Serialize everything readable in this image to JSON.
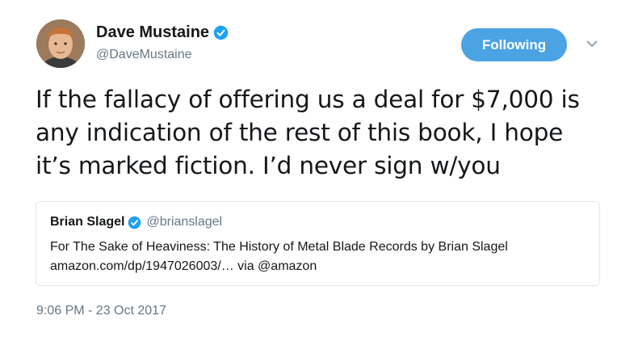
{
  "author": {
    "display_name": "Dave Mustaine",
    "handle": "@DaveMustaine",
    "verified_icon": "verified-badge-icon"
  },
  "follow_button": {
    "label": "Following"
  },
  "menu_icon": "chevron-down-icon",
  "tweet": {
    "lines": [
      "If the fallacy of offering us a deal for $7,000 is",
      "any indication of the rest of this book, I hope",
      "it’s marked fiction. I’d never sign w/you"
    ]
  },
  "quoted_tweet": {
    "display_name": "Brian Slagel",
    "handle": "@brianslagel",
    "line1": "For The Sake of Heaviness: The History of Metal Blade Records by Brian Slagel",
    "line2": "amazon.com/dp/1947026003/… via @amazon"
  },
  "timestamp": "9:06 PM - 23 Oct 2017",
  "colors": {
    "accent": "#4ba3e4",
    "secondary_text": "#657786",
    "border": "#e1e8ed"
  }
}
